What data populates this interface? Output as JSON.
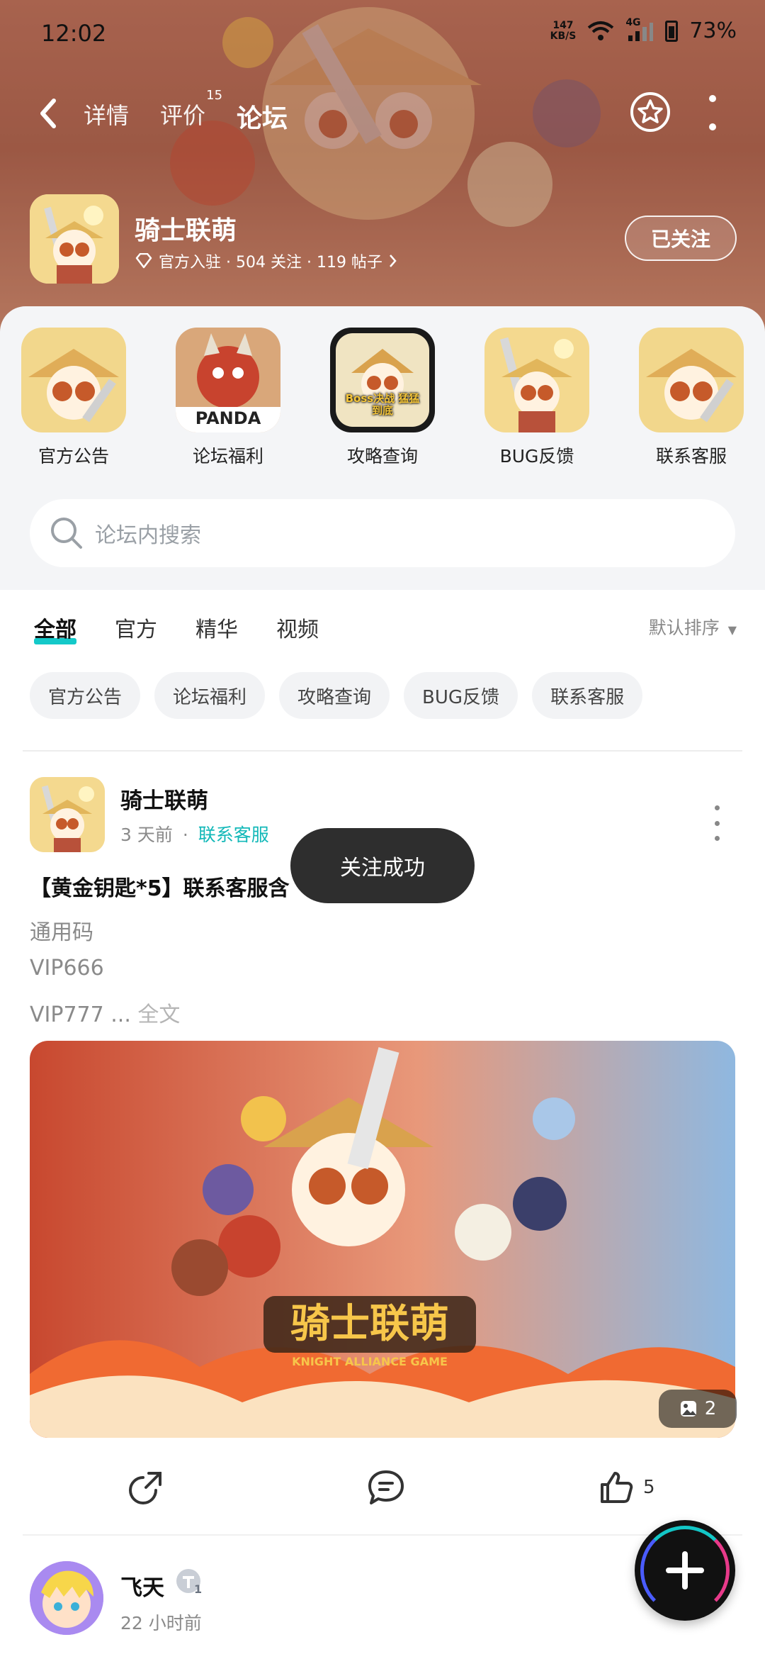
{
  "status_bar": {
    "time": "12:02",
    "net_speed_value": "147",
    "net_speed_unit": "KB/S",
    "network": "4G",
    "battery": "73%"
  },
  "nav": {
    "tabs": [
      {
        "label": "详情",
        "active": false
      },
      {
        "label": "评价",
        "active": false,
        "badge": "15"
      },
      {
        "label": "论坛",
        "active": true
      }
    ]
  },
  "game": {
    "name": "骑士联萌",
    "stats": "官方入驻 · 504 关注 · 119 帖子",
    "follow_label": "已关注"
  },
  "quick_links": [
    {
      "label": "官方公告"
    },
    {
      "label": "论坛福利",
      "icon_text": "PANDA"
    },
    {
      "label": "攻略查询",
      "icon_text": "Boss决战 猛猛到底"
    },
    {
      "label": "BUG反馈"
    },
    {
      "label": "联系客服"
    }
  ],
  "search": {
    "placeholder": "论坛内搜索"
  },
  "filter_tabs": [
    {
      "label": "全部",
      "active": true
    },
    {
      "label": "官方",
      "active": false
    },
    {
      "label": "精华",
      "active": false
    },
    {
      "label": "视频",
      "active": false
    }
  ],
  "sort_label": "默认排序",
  "chips": [
    "官方公告",
    "论坛福利",
    "攻略查询",
    "BUG反馈",
    "联系客服"
  ],
  "post": {
    "author": "骑士联萌",
    "time": "3 天前",
    "separator": "·",
    "category": "联系客服",
    "title": "【黄金钥匙*5】联系客服含",
    "lines": [
      "通用码",
      "VIP666",
      "VIP777 ..."
    ],
    "full_text_label": "全文",
    "image_count": "2",
    "logo_text": "骑士联萌",
    "logo_sub": "KNIGHT ALLIANCE GAME",
    "like_count": "5"
  },
  "post2": {
    "author": "飞天",
    "level": "1",
    "time": "22 小时前"
  },
  "toast": "关注成功",
  "colors": {
    "accent": "#14c9c9",
    "hero": "#b8705a",
    "toast_bg": "#2e2e2e"
  }
}
